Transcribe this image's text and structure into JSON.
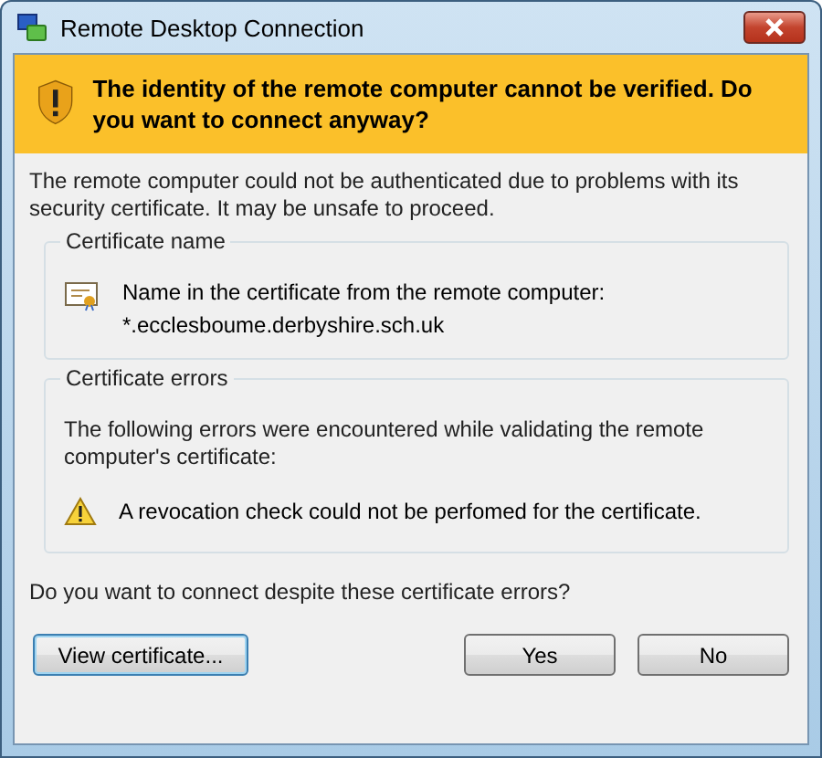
{
  "window": {
    "title": "Remote Desktop Connection"
  },
  "banner": {
    "text": "The identity of the remote computer cannot be verified. Do you want to connect anyway?"
  },
  "intro": "The remote computer could not be authenticated due to problems with its security certificate. It may be unsafe to proceed.",
  "groups": [
    {
      "title": "Certificate name",
      "kind": "certificate",
      "lines": [
        "Name in the certificate from the remote computer:",
        "*.ecclesboume.derbyshire.sch.uk"
      ]
    },
    {
      "title": "Certificate errors",
      "kind": "errors",
      "description": "The following errors were encountered while validating the remote computer's certificate:",
      "errors": [
        "A revocation check could not be perfomed for the certificate."
      ]
    }
  ],
  "question": "Do you want to connect despite these certificate errors?",
  "buttons": [
    {
      "label": "View certificate...",
      "focused": true
    },
    {
      "label": "Yes",
      "focused": false
    },
    {
      "label": "No",
      "focused": false
    }
  ]
}
